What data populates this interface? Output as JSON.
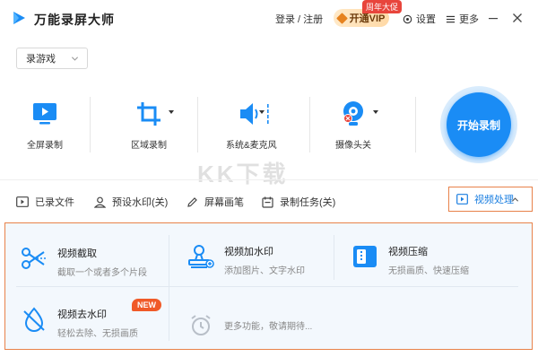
{
  "window": {
    "title": "万能录屏大师",
    "login_label": "登录 / 注册",
    "vip_label": "开通VIP",
    "vip_badge": "周年大促",
    "settings_label": "设置",
    "more_label": "更多"
  },
  "mode_select": {
    "value": "录游戏"
  },
  "tools": {
    "fullscreen": "全屏录制",
    "region": "区域录制",
    "audio": "系统&麦克风",
    "camera": "摄像头关"
  },
  "start_button": "开始录制",
  "watermark": "KK下载",
  "bottom_bar": {
    "recorded_files": "已录文件",
    "preset_watermark": "预设水印(关)",
    "screen_brush": "屏幕画笔",
    "record_task": "录制任务(关)",
    "video_processing": "视频处理"
  },
  "panel": {
    "cards": [
      {
        "title": "视频截取",
        "desc": "截取一个或者多个片段",
        "icon": "scissors-icon"
      },
      {
        "title": "视频加水印",
        "desc": "添加图片、文字水印",
        "icon": "stamp-icon"
      },
      {
        "title": "视频压缩",
        "desc": "无损画质、快速压缩",
        "icon": "compress-icon"
      },
      {
        "title": "视频去水印",
        "desc": "轻松去除、无损画质",
        "icon": "droplet-slash-icon"
      },
      {
        "title": "",
        "desc": "更多功能，敬请期待...",
        "icon": "alarm-clock-icon"
      }
    ],
    "new_badge": "NEW"
  },
  "colors": {
    "accent": "#1a8cf5",
    "highlight_border": "#e8824a",
    "panel_bg": "#f3f8fd"
  }
}
